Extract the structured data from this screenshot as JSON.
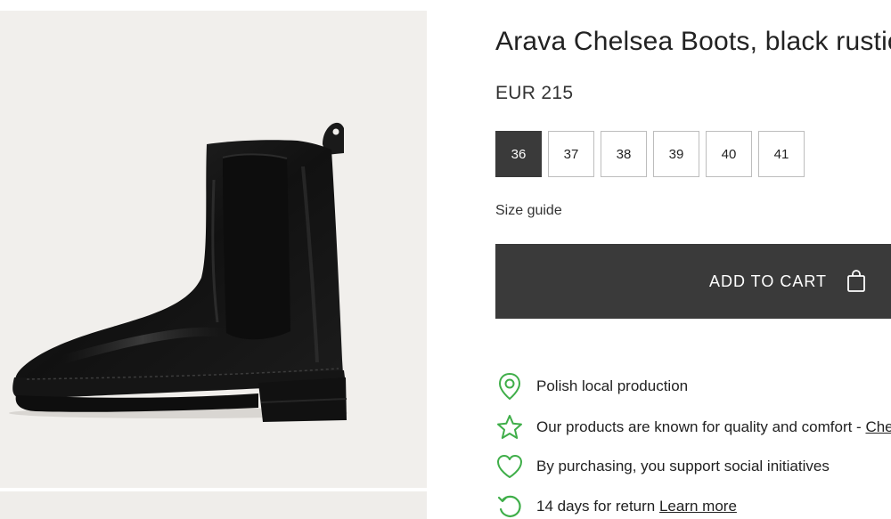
{
  "product": {
    "title": "Arava Chelsea Boots, black rustic",
    "price": "EUR 215",
    "image_alt": "black leather chelsea boot"
  },
  "sizes": [
    {
      "label": "36",
      "selected": true
    },
    {
      "label": "37",
      "selected": false
    },
    {
      "label": "38",
      "selected": false
    },
    {
      "label": "39",
      "selected": false
    },
    {
      "label": "40",
      "selected": false
    },
    {
      "label": "41",
      "selected": false
    }
  ],
  "size_guide_label": "Size guide",
  "cart": {
    "label": "ADD TO CART",
    "icon": "shopping-bag-icon"
  },
  "features": [
    {
      "icon": "location-pin-icon",
      "text": "Polish local production",
      "link": ""
    },
    {
      "icon": "star-icon",
      "text": "Our products are known for quality and comfort - ",
      "link": "Check reviews"
    },
    {
      "icon": "heart-icon",
      "text": "By purchasing, you support social initiatives",
      "link": ""
    },
    {
      "icon": "return-arrow-icon",
      "text": "14 days for return ",
      "link": "Learn more"
    }
  ],
  "colors": {
    "accent_green": "#3fae49",
    "button_dark": "#3a3a3a",
    "image_background": "#f1efec"
  }
}
